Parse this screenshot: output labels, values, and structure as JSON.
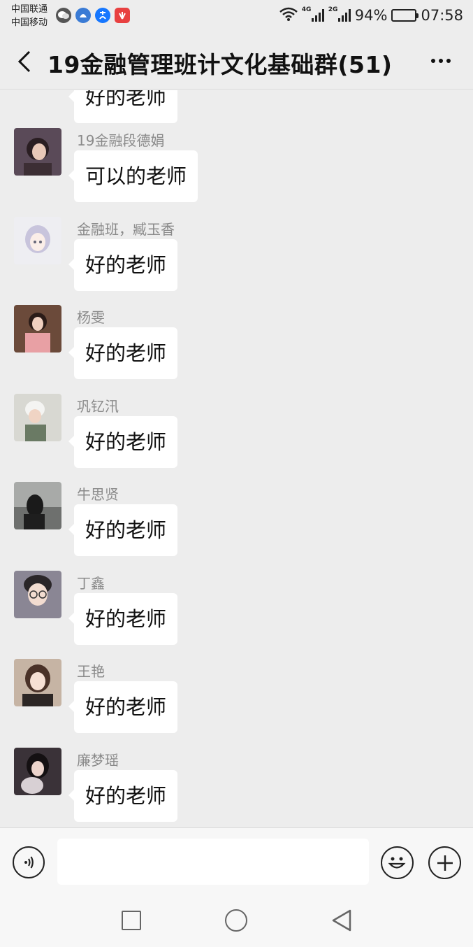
{
  "status_bar": {
    "carrier_1": "中国联通",
    "carrier_2": "中国移动",
    "net_1": "4G",
    "net_2": "2G",
    "battery": "94%",
    "battery_level": 0.94,
    "time": "07:58"
  },
  "header": {
    "title": "19金融管理班计文化基础群(51)"
  },
  "messages": [
    {
      "sender": "",
      "text": "好的老师"
    },
    {
      "sender": "19金融段德娟",
      "text": "可以的老师"
    },
    {
      "sender": "金融班，臧玉香",
      "text": "好的老师"
    },
    {
      "sender": "杨雯",
      "text": "好的老师"
    },
    {
      "sender": "巩钇汛",
      "text": "好的老师"
    },
    {
      "sender": "牛思贤",
      "text": "好的老师"
    },
    {
      "sender": "丁鑫",
      "text": "好的老师"
    },
    {
      "sender": "王艳",
      "text": "好的老师"
    },
    {
      "sender": "廉梦瑶",
      "text": "好的老师"
    }
  ],
  "input": {
    "value": "",
    "placeholder": ""
  },
  "icons": {
    "back": "chevron-left-icon",
    "more": "more-dots-icon",
    "voice": "voice-icon",
    "emoji": "emoji-icon",
    "plus": "plus-icon"
  }
}
